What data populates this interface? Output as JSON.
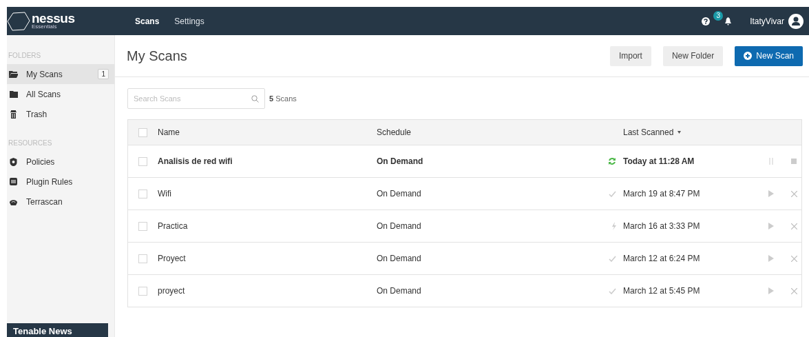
{
  "header": {
    "logo": {
      "name": "nessus",
      "edition": "Essentials"
    },
    "nav": [
      {
        "label": "Scans",
        "selected": true
      },
      {
        "label": "Settings",
        "selected": false
      }
    ],
    "notifications": {
      "count": "3"
    },
    "user": {
      "name": "ItatyVivar"
    }
  },
  "sidebar": {
    "sections": [
      {
        "title": "FOLDERS",
        "items": [
          {
            "label": "My Scans",
            "selected": true,
            "count": "1"
          },
          {
            "label": "All Scans",
            "selected": false
          },
          {
            "label": "Trash",
            "selected": false
          }
        ]
      },
      {
        "title": "RESOURCES",
        "items": [
          {
            "label": "Policies",
            "selected": false
          },
          {
            "label": "Plugin Rules",
            "selected": false
          },
          {
            "label": "Terrascan",
            "selected": false
          }
        ]
      }
    ],
    "news": {
      "title": "Tenable News"
    }
  },
  "main": {
    "title": "My Scans",
    "buttons": [
      {
        "label": "Import",
        "kind": "plain"
      },
      {
        "label": "New Folder",
        "kind": "plain"
      },
      {
        "label": "New Scan",
        "kind": "primary"
      }
    ],
    "search": {
      "placeholder": "Search Scans"
    },
    "count": {
      "number": "5",
      "label": "Scans"
    },
    "table": {
      "all_checked": false,
      "columns": [
        "Name",
        "Schedule",
        "Last Scanned"
      ],
      "rows": [
        {
          "checked": false,
          "name": "Analisis de red wifi",
          "schedule": "On Demand",
          "kind": "running",
          "last_scanned": "Today at 11:28 AM"
        },
        {
          "checked": false,
          "name": "Wifi",
          "schedule": "On Demand",
          "kind": "completed",
          "last_scanned": "March 19 at 8:47 PM"
        },
        {
          "checked": false,
          "name": "Practica",
          "schedule": "On Demand",
          "kind": "aborted",
          "last_scanned": "March 16 at 3:33 PM"
        },
        {
          "checked": false,
          "name": "Proyect",
          "schedule": "On Demand",
          "kind": "completed",
          "last_scanned": "March 12 at 6:24 PM"
        },
        {
          "checked": false,
          "name": "proyect",
          "schedule": "On Demand",
          "kind": "completed",
          "last_scanned": "March 12 at 5:45 PM"
        }
      ]
    }
  }
}
